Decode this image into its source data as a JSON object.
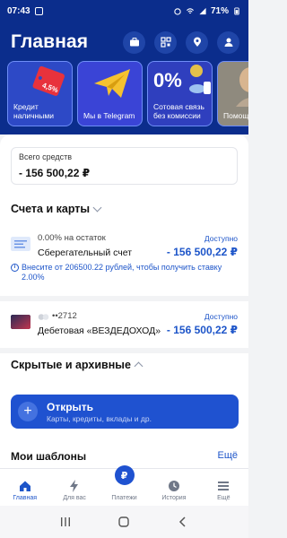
{
  "status_bar": {
    "time": "07:43",
    "battery": "71%"
  },
  "header": {
    "title": "Главная",
    "buttons": [
      "briefcase-icon",
      "qr-scan-icon",
      "location-pin-icon",
      "user-icon"
    ]
  },
  "stories": [
    {
      "label": "Кредит наличными",
      "badge": "4,5%"
    },
    {
      "label": "Мы в Telegram"
    },
    {
      "label": "Сотовая связь без комиссии",
      "big": "0%"
    },
    {
      "label": "Помощь на дор"
    }
  ],
  "total": {
    "label": "Всего средств",
    "value": "- 156 500,22 ₽"
  },
  "accounts_section": {
    "title": "Счета и карты"
  },
  "accounts": [
    {
      "subtitle": "0.00% на остаток",
      "name": "Сберегательный счет",
      "status": "Доступно",
      "amount": "- 156 500,22 ₽",
      "note": "Внесите от 206500.22 рублей, чтобы получить ставку 2.00%"
    },
    {
      "subtitle": "••2712",
      "name": "Дебетовая «ВЕЗДЕДОХОД»",
      "status": "Доступно",
      "amount": "- 156 500,22 ₽"
    }
  ],
  "hidden_section": {
    "title": "Скрытые и архивные"
  },
  "open_button": {
    "title": "Открыть",
    "subtitle": "Карты, кредиты, вклады и др."
  },
  "templates": {
    "title": "Мои шаблоны",
    "more": "Ещё"
  },
  "bottom_nav": [
    {
      "label": "Главная",
      "icon": "home-icon",
      "active": true
    },
    {
      "label": "Для вас",
      "icon": "lightning-icon"
    },
    {
      "label": "Платежи",
      "icon": "ruble-icon",
      "glyph": "₽"
    },
    {
      "label": "История",
      "icon": "clock-icon"
    },
    {
      "label": "Ещё",
      "icon": "menu-icon"
    }
  ],
  "colors": {
    "primary": "#0b2d8c",
    "accent": "#1d55c9",
    "button": "#1f52d0"
  }
}
